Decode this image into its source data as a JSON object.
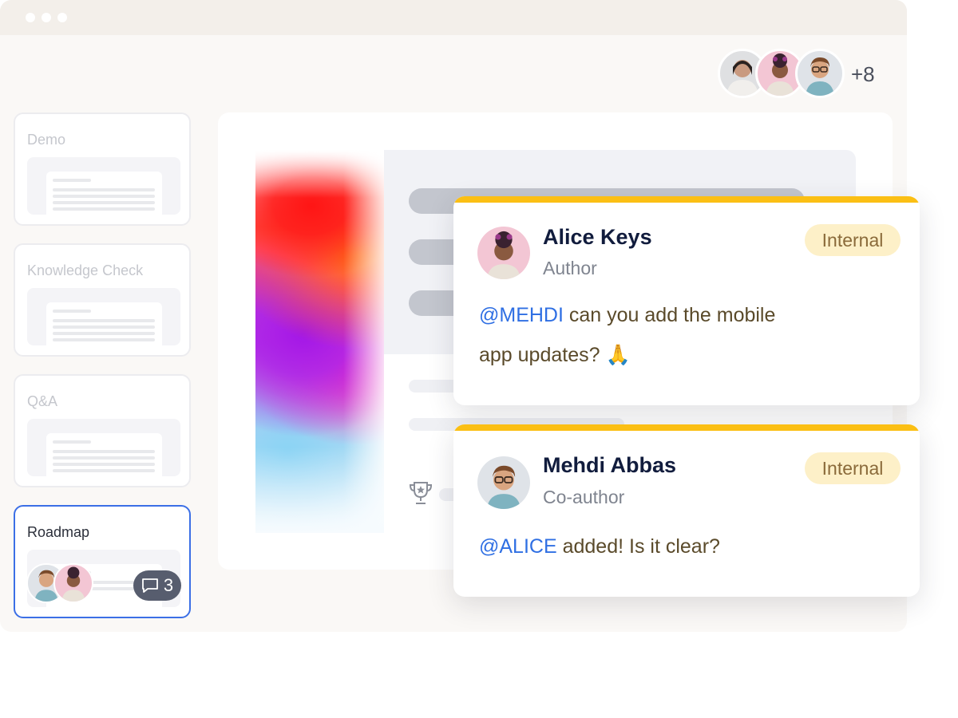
{
  "header": {
    "more_collaborators": "+8"
  },
  "slides": [
    {
      "title": "Demo"
    },
    {
      "title": "Knowledge Check"
    },
    {
      "title": "Q&A"
    },
    {
      "title": "Roadmap",
      "comment_count": "3"
    }
  ],
  "comments": [
    {
      "name": "Alice Keys",
      "role": "Author",
      "badge": "Internal",
      "mention": "@MEHDI",
      "text_line1": " can you add the mobile",
      "text_line2": "app updates? 🙏"
    },
    {
      "name": "Mehdi Abbas",
      "role": "Co-author",
      "badge": "Internal",
      "mention": "@ALICE",
      "text_line1": " added! Is it clear?"
    }
  ],
  "colors": {
    "accent_blue": "#3b6fe6",
    "comment_bar": "#fbbf14",
    "badge_bg": "#fdf0c8",
    "mention": "#2f6fe3"
  }
}
